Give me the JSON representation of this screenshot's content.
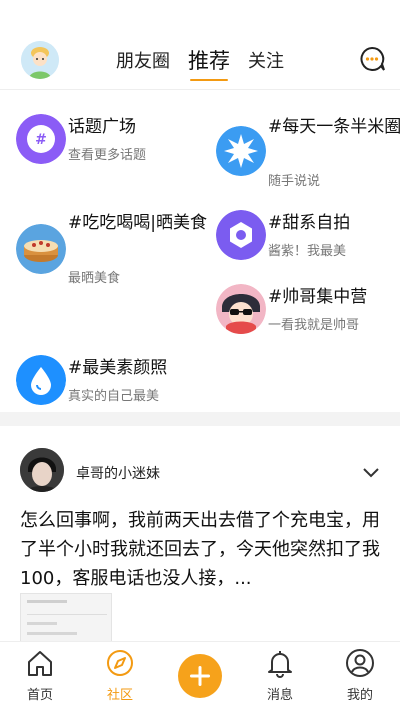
{
  "header": {
    "tabs": [
      {
        "label": "朋友圈"
      },
      {
        "label": "推荐"
      },
      {
        "label": "关注"
      }
    ],
    "active_tab": "推荐"
  },
  "topics": [
    {
      "title": "话题广场",
      "subtitle": "查看更多话题",
      "icon": "hashtag-icon"
    },
    {
      "title": "#每天一条半米圈",
      "subtitle": "随手说说",
      "icon": "sun-icon"
    },
    {
      "title": "#吃吃喝喝|晒美食",
      "subtitle": "最晒美食",
      "icon": "cake-icon"
    },
    {
      "title": "#甜系自拍",
      "subtitle": "酱紫！我最美",
      "icon": "camera-lens-icon"
    },
    {
      "title": "#帅哥集中营",
      "subtitle": "一看我就是帅哥",
      "icon": "cool-avatar-icon"
    },
    {
      "title": "#最美素颜照",
      "subtitle": "真实的自己最美",
      "icon": "water-drop-icon"
    }
  ],
  "post": {
    "username": "卓哥的小迷妹",
    "text": "怎么回事啊，我前两天出去借了个充电宝，用了半个小时我就还回去了，今天他突然扣了我100，客服电话也没人接，..."
  },
  "tabbar": {
    "items": [
      {
        "label": "首页",
        "icon": "home-icon"
      },
      {
        "label": "社区",
        "icon": "compass-icon"
      },
      {
        "label": "",
        "icon": "plus-icon"
      },
      {
        "label": "消息",
        "icon": "bell-icon"
      },
      {
        "label": "我的",
        "icon": "profile-icon"
      }
    ],
    "active": "社区"
  },
  "colors": {
    "accent": "#f39a12",
    "purple": "#8b5cf6",
    "blue": "#3b9cf2"
  }
}
